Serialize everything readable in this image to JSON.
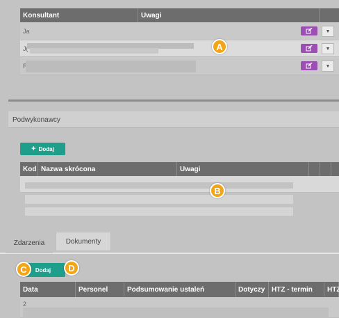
{
  "consultants_table": {
    "headers": [
      "Konsultant",
      "Uwagi"
    ],
    "rows": [
      {
        "prefix": "Ja"
      },
      {
        "prefix": "J("
      },
      {
        "prefix": "R"
      }
    ]
  },
  "subcontractors": {
    "section_title": "Podwykonawcy",
    "add_label": "Dodaj",
    "headers": [
      "Kod",
      "Nazwa skrócona",
      "Uwagi"
    ]
  },
  "tabs": [
    "Zdarzenia",
    "Dokumenty"
  ],
  "events": {
    "add_label": "Dodaj",
    "headers": [
      "Data",
      "Personel",
      "Podsumowanie ustaleń",
      "Dotyczy",
      "HTZ - termin",
      "HTZ"
    ],
    "row_prefix": "2"
  },
  "annotations": [
    "A",
    "B",
    "C",
    "D"
  ],
  "icons": {
    "edit": "edit-icon",
    "caret": "caret-down-icon",
    "plus": "plus-icon"
  },
  "colors": {
    "edit_button": "#9b4fb3",
    "add_button": "#1f9f8b",
    "badge": "#f2a516",
    "header": "#6d6d6d"
  }
}
